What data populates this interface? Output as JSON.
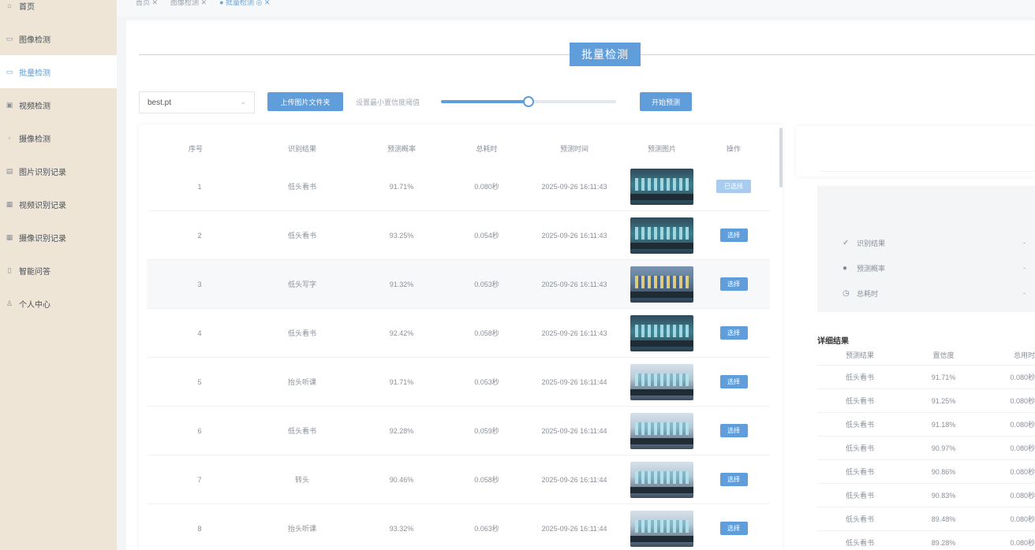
{
  "sidebar": {
    "items": [
      {
        "label": "首页",
        "icon": "home-icon",
        "glyph": "⌂"
      },
      {
        "label": "图像检测",
        "icon": "image-icon",
        "glyph": "▭"
      },
      {
        "label": "批量检测",
        "icon": "batch-icon",
        "glyph": "▭",
        "active": true
      },
      {
        "label": "视频检测",
        "icon": "video-icon",
        "glyph": "▣"
      },
      {
        "label": "摄像检测",
        "icon": "camera-icon",
        "glyph": "◦"
      },
      {
        "label": "图片识别记录",
        "icon": "image-record-icon",
        "glyph": "▤"
      },
      {
        "label": "视频识别记录",
        "icon": "video-record-icon",
        "glyph": "▦"
      },
      {
        "label": "摄像识别记录",
        "icon": "camera-record-icon",
        "glyph": "▦"
      },
      {
        "label": "智能问答",
        "icon": "qa-icon",
        "glyph": "▯"
      },
      {
        "label": "个人中心",
        "icon": "user-icon",
        "glyph": "♙"
      }
    ]
  },
  "breadcrumb": {
    "items": [
      "首页 ✕",
      "图像检测 ✕",
      "● 批量检测 ◎ ✕"
    ]
  },
  "header": {
    "title": "批量检测"
  },
  "toolbar": {
    "model_value": "best.pt",
    "upload_label": "上传图片文件夹",
    "threshold_label": "设置最小置信度阈值",
    "threshold_value": 0.5,
    "start_label": "开始预测"
  },
  "table": {
    "columns": [
      "序号",
      "识别结果",
      "预测概率",
      "总耗时",
      "预测时间",
      "预测图片",
      "操作"
    ],
    "rows": [
      {
        "idx": "1",
        "result": "低头看书",
        "prob": "91.71%",
        "time": "0.080秒",
        "datetime": "2025-09-26 16:11:43",
        "action": "已选择",
        "selected": true,
        "img": "dark"
      },
      {
        "idx": "2",
        "result": "低头看书",
        "prob": "93.25%",
        "time": "0.054秒",
        "datetime": "2025-09-26 16:11:43",
        "action": "选择",
        "img": "dark"
      },
      {
        "idx": "3",
        "result": "低头写字",
        "prob": "91.32%",
        "time": "0.053秒",
        "datetime": "2025-09-26 16:11:43",
        "action": "选择",
        "img": "lit"
      },
      {
        "idx": "4",
        "result": "低头看书",
        "prob": "92.42%",
        "time": "0.058秒",
        "datetime": "2025-09-26 16:11:43",
        "action": "选择",
        "img": "dark"
      },
      {
        "idx": "5",
        "result": "抬头听课",
        "prob": "91.71%",
        "time": "0.053秒",
        "datetime": "2025-09-26 16:11:44",
        "action": "选择",
        "img": "pale"
      },
      {
        "idx": "6",
        "result": "低头看书",
        "prob": "92.28%",
        "time": "0.059秒",
        "datetime": "2025-09-26 16:11:44",
        "action": "选择",
        "img": "pale"
      },
      {
        "idx": "7",
        "result": "转头",
        "prob": "90.46%",
        "time": "0.058秒",
        "datetime": "2025-09-26 16:11:44",
        "action": "选择",
        "img": "pale"
      },
      {
        "idx": "8",
        "result": "抬头听课",
        "prob": "93.32%",
        "time": "0.063秒",
        "datetime": "2025-09-26 16:11:44",
        "action": "选择",
        "img": "pale"
      }
    ]
  },
  "summary": {
    "items": [
      {
        "label": "识别结果",
        "icon": "check-icon",
        "glyph": "✓",
        "value": "-"
      },
      {
        "label": "预测概率",
        "icon": "location-icon",
        "glyph": "●",
        "value": "-"
      },
      {
        "label": "总耗时",
        "icon": "clock-icon",
        "glyph": "◷",
        "value": "-"
      }
    ]
  },
  "detail": {
    "title": "详细结果",
    "columns": [
      "预测结果",
      "置信度",
      "总用时"
    ],
    "rows": [
      [
        "低头看书",
        "91.71%",
        "0.080秒"
      ],
      [
        "低头看书",
        "91.25%",
        "0.080秒"
      ],
      [
        "低头看书",
        "91.18%",
        "0.080秒"
      ],
      [
        "低头看书",
        "90.97%",
        "0.080秒"
      ],
      [
        "低头看书",
        "90.86%",
        "0.080秒"
      ],
      [
        "低头看书",
        "90.83%",
        "0.080秒"
      ],
      [
        "低头看书",
        "89.48%",
        "0.080秒"
      ],
      [
        "低头看书",
        "89.28%",
        "0.080秒"
      ]
    ]
  },
  "colors": {
    "accent": "#5f9ddb",
    "sidebar_bg": "#efe5d7",
    "selected_button": "#a9cbed"
  }
}
